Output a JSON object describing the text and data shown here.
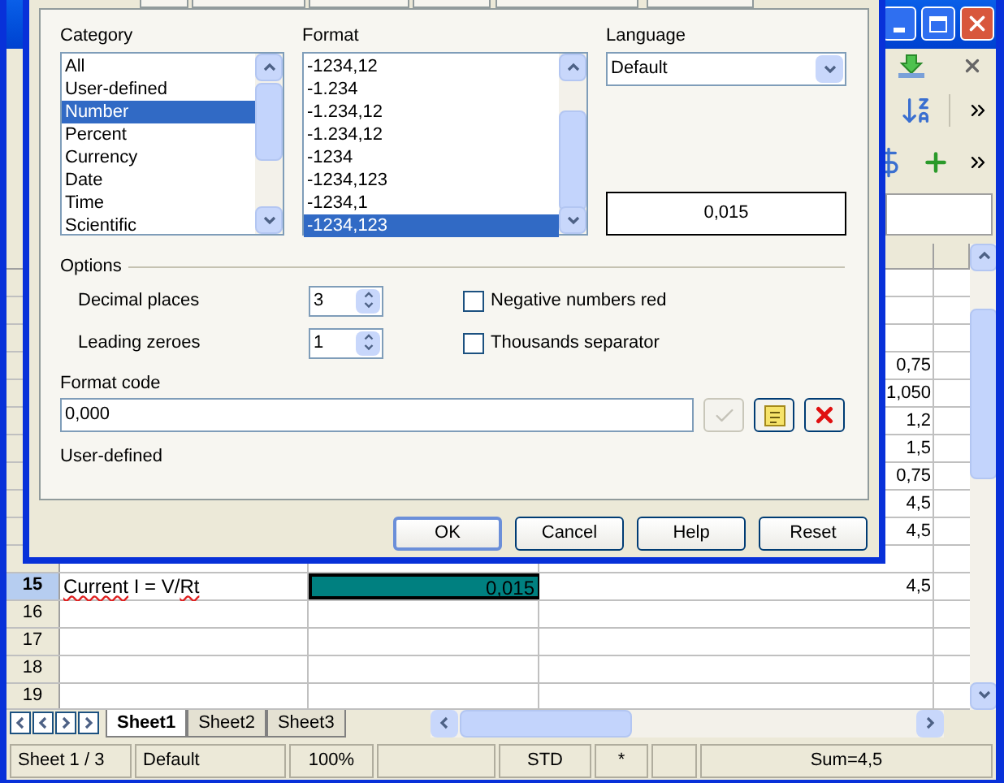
{
  "dialog": {
    "category": {
      "label": "Category",
      "items": [
        {
          "label": "All",
          "selected": false
        },
        {
          "label": "User-defined",
          "selected": false
        },
        {
          "label": "Number",
          "selected": true
        },
        {
          "label": "Percent",
          "selected": false
        },
        {
          "label": "Currency",
          "selected": false
        },
        {
          "label": "Date",
          "selected": false
        },
        {
          "label": "Time",
          "selected": false
        },
        {
          "label": "Scientific",
          "selected": false
        }
      ]
    },
    "format": {
      "label": "Format",
      "items": [
        {
          "label": "-1234,12",
          "selected": false
        },
        {
          "label": "-1.234",
          "selected": false
        },
        {
          "label": "-1.234,12",
          "selected": false
        },
        {
          "label": "-1.234,12",
          "selected": false
        },
        {
          "label": "-1234",
          "selected": false
        },
        {
          "label": "-1234,123",
          "selected": false
        },
        {
          "label": "-1234,1",
          "selected": false
        },
        {
          "label": "-1234,123",
          "selected": true
        }
      ]
    },
    "language": {
      "label": "Language",
      "value": "Default"
    },
    "preview": "0,015",
    "options": {
      "title": "Options",
      "spinners": [
        {
          "label": "Decimal places",
          "value": "3"
        },
        {
          "label": "Leading zeroes",
          "value": "1"
        }
      ],
      "checkboxes": [
        {
          "label": "Negative numbers red",
          "checked": false
        },
        {
          "label": "Thousands separator",
          "checked": false
        }
      ]
    },
    "format_code": {
      "label": "Format code",
      "value": "0,000",
      "description": "User-defined"
    },
    "buttons": [
      {
        "label": "OK",
        "default": true
      },
      {
        "label": "Cancel",
        "default": false
      },
      {
        "label": "Help",
        "default": false
      },
      {
        "label": "Reset",
        "default": false
      }
    ]
  },
  "sheet": {
    "rows": [
      {},
      {},
      {},
      {
        "column_3": "0,75"
      },
      {
        "column_3": "1,050"
      },
      {
        "column_3": "1,2"
      },
      {
        "column_3": "1,5"
      },
      {
        "column_3": "0,75"
      },
      {
        "column_3": "4,5"
      },
      {
        "column_3": "4,5"
      },
      {},
      {
        "header": "15",
        "selected": true,
        "column_1": [
          {
            "text": "Current",
            "misspelled": true
          },
          {
            "text": " I = V/",
            "misspelled": false
          },
          {
            "text": "Rt",
            "misspelled": true
          }
        ],
        "column_2": "0,015",
        "column_3": "4,5"
      },
      {
        "header": "16",
        "selected": false
      },
      {
        "header": "17",
        "selected": false
      },
      {
        "header": "18",
        "selected": false
      },
      {
        "header": "19",
        "selected": false
      }
    ],
    "tabs": [
      {
        "label": "Sheet1",
        "selected": true
      },
      {
        "label": "Sheet2",
        "selected": false
      },
      {
        "label": "Sheet3",
        "selected": false
      }
    ]
  },
  "status_bar": [
    {
      "kind": "text",
      "text": "Sheet 1 / 3"
    },
    {
      "kind": "text",
      "text": "Default"
    },
    {
      "kind": "text",
      "text": "100%"
    },
    {
      "kind": "blank"
    },
    {
      "kind": "text",
      "text": "STD"
    },
    {
      "kind": "text",
      "text": "*"
    },
    {
      "kind": "blank"
    },
    {
      "kind": "text",
      "text": "Sum=4,5"
    }
  ]
}
